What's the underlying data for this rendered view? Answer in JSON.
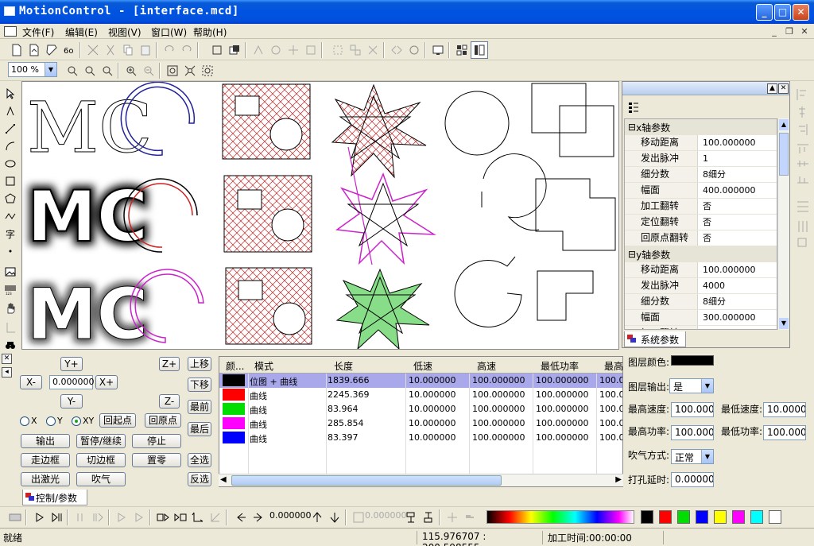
{
  "window": {
    "title": "MotionControl - [interface.mcd]"
  },
  "menu": [
    "文件(F)",
    "编辑(E)",
    "视图(V)",
    "窗口(W)",
    "帮助(H)"
  ],
  "zoom": {
    "value": "100 %"
  },
  "props": {
    "groups": [
      {
        "label": "x轴参数",
        "rows": [
          {
            "key": "移动距离",
            "value": "100.000000"
          },
          {
            "key": "发出脉冲",
            "value": "1"
          },
          {
            "key": "细分数",
            "value": "8细分"
          },
          {
            "key": "幅面",
            "value": "400.000000"
          },
          {
            "key": "加工翻转",
            "value": "否"
          },
          {
            "key": "定位翻转",
            "value": "否"
          },
          {
            "key": "回原点翻转",
            "value": "否"
          }
        ]
      },
      {
        "label": "y轴参数",
        "rows": [
          {
            "key": "移动距离",
            "value": "100.000000"
          },
          {
            "key": "发出脉冲",
            "value": "4000"
          },
          {
            "key": "细分数",
            "value": "8细分"
          },
          {
            "key": "幅面",
            "value": "300.000000"
          },
          {
            "key": "加工翻转",
            "value": "否"
          }
        ]
      }
    ],
    "tab": "系统参数"
  },
  "control": {
    "btn_yplus": "Y+",
    "btn_zplus": "Z+",
    "btn_up": "上移",
    "btn_xminus": "X-",
    "step_value": "0.000000",
    "btn_xplus": "X+",
    "btn_down": "下移",
    "btn_yminus": "Y-",
    "btn_zminus": "Z-",
    "btn_front": "最前",
    "radio_x": "X",
    "radio_y": "Y",
    "radio_xy": "XY",
    "btn_return_start": "回起点",
    "btn_return_origin": "回原点",
    "btn_back": "最后",
    "btn_output": "输出",
    "btn_pause": "暂停/继续",
    "btn_stop": "停止",
    "btn_walk_frame": "走边框",
    "btn_cut_frame": "切边框",
    "btn_reset": "置零",
    "btn_select_all": "全选",
    "btn_laser": "出激光",
    "btn_blow": "吹气",
    "btn_invert": "反选",
    "tab": "控制/参数"
  },
  "layers": {
    "headers": [
      "颜...",
      "模式",
      "长度",
      "低速",
      "高速",
      "最低功率",
      "最高"
    ],
    "rows": [
      {
        "color": "#000000",
        "mode": "位图 + 曲线",
        "length": "1839.666",
        "low": "10.000000",
        "high": "100.000000",
        "minp": "100.000000",
        "maxp": "100.00"
      },
      {
        "color": "#ff0000",
        "mode": "曲线",
        "length": "2245.369",
        "low": "10.000000",
        "high": "100.000000",
        "minp": "100.000000",
        "maxp": "100.00"
      },
      {
        "color": "#00dd00",
        "mode": "曲线",
        "length": "83.964",
        "low": "10.000000",
        "high": "100.000000",
        "minp": "100.000000",
        "maxp": "100.00"
      },
      {
        "color": "#ff00ff",
        "mode": "曲线",
        "length": "285.854",
        "low": "10.000000",
        "high": "100.000000",
        "minp": "100.000000",
        "maxp": "100.00"
      },
      {
        "color": "#0000ff",
        "mode": "曲线",
        "length": "83.397",
        "low": "10.000000",
        "high": "100.000000",
        "minp": "100.000000",
        "maxp": "100.00"
      }
    ]
  },
  "layer_props": {
    "color_label": "图层颜色:",
    "output_label": "图层输出:",
    "output_value": "是",
    "max_speed_label": "最高速度:",
    "max_speed": "100.000000",
    "min_speed_label": "最低速度:",
    "min_speed": "10.000000",
    "max_power_label": "最高功率:",
    "max_power": "100.000000",
    "min_power_label": "最低功率:",
    "min_power": "100.000000",
    "blow_label": "吹气方式:",
    "blow_value": "正常",
    "drill_label": "打孔延时:",
    "drill_value": "0.000000"
  },
  "bottom": {
    "step": "0.000000",
    "step_disabled": "0.000000"
  },
  "palette": [
    "#000000",
    "#ff0000",
    "#00dd00",
    "#0000ff",
    "#ffff00",
    "#ff00ff",
    "#00ffff",
    "#ffffff"
  ],
  "status": {
    "ready": "就绪",
    "coords": "115.976707 : 200.598555",
    "time": "加工时间:00:00:00"
  }
}
